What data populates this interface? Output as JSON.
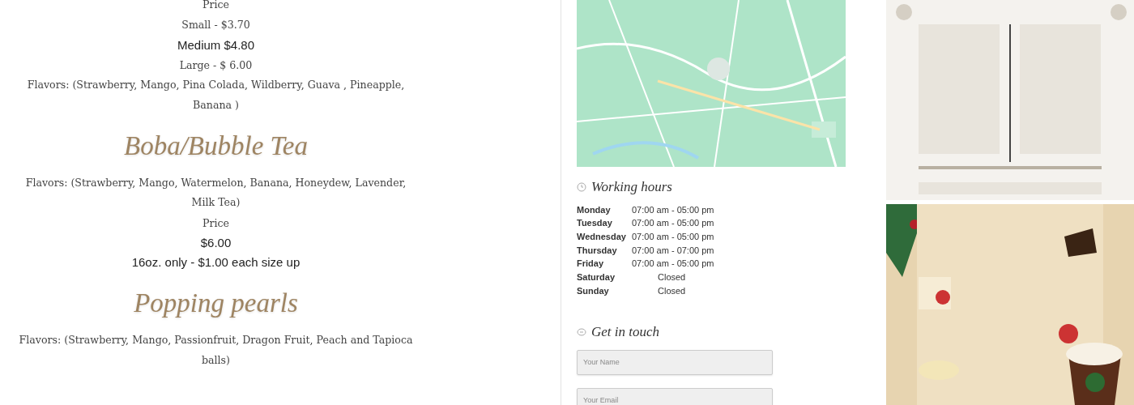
{
  "menu": [
    {
      "kind": "line",
      "text": "Price"
    },
    {
      "kind": "line",
      "text": "Small - $3.70"
    },
    {
      "kind": "emphasis",
      "text": "Medium $4.80"
    },
    {
      "kind": "line",
      "text": "Large - $ 6.00"
    },
    {
      "kind": "line",
      "text": "Flavors: (Strawberry, Mango, Pina Colada, Wildberry, Guava , Pineapple, Banana )"
    },
    {
      "kind": "heading",
      "text": "Boba/Bubble Tea"
    },
    {
      "kind": "line",
      "text": "Flavors: (Strawberry, Mango, Watermelon, Banana, Honeydew, Lavender, Milk Tea)"
    },
    {
      "kind": "line",
      "text": "Price"
    },
    {
      "kind": "emphasis",
      "text": "$6.00"
    },
    {
      "kind": "emphasis",
      "text": "16oz. only  -  $1.00 each size up"
    },
    {
      "kind": "heading",
      "text": "Popping pearls"
    },
    {
      "kind": "line",
      "text": "Flavors: (Strawberry, Mango, Passionfruit, Dragon Fruit, Peach and Tapioca balls)"
    }
  ],
  "working_hours": {
    "title": "Working hours",
    "rows": [
      {
        "day": "Monday",
        "hours": "07:00 am - 05:00 pm",
        "closed": false
      },
      {
        "day": "Tuesday",
        "hours": "07:00 am - 05:00 pm",
        "closed": false
      },
      {
        "day": "Wednesday",
        "hours": "07:00 am - 05:00 pm",
        "closed": false
      },
      {
        "day": "Thursday",
        "hours": "07:00 am - 07:00 pm",
        "closed": false
      },
      {
        "day": "Friday",
        "hours": "07:00 am - 05:00 pm",
        "closed": false
      },
      {
        "day": "Saturday",
        "hours": "Closed",
        "closed": true
      },
      {
        "day": "Sunday",
        "hours": "Closed",
        "closed": true
      }
    ]
  },
  "contact": {
    "title": "Get in touch",
    "fields": [
      {
        "placeholder": "Your Name"
      },
      {
        "placeholder": "Your Email"
      }
    ]
  }
}
